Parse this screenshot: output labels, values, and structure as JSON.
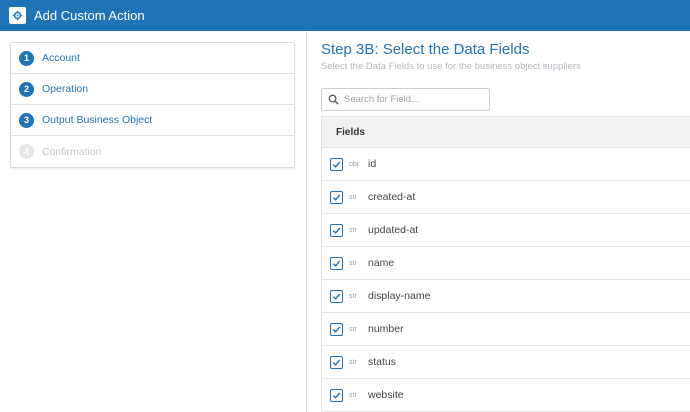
{
  "header": {
    "title": "Add Custom Action"
  },
  "steps": [
    {
      "num": "1",
      "label": "Account",
      "enabled": true
    },
    {
      "num": "2",
      "label": "Operation",
      "enabled": true
    },
    {
      "num": "3",
      "label": "Output Business Object",
      "enabled": true
    },
    {
      "num": "4",
      "label": "Confirmation",
      "enabled": false
    }
  ],
  "main": {
    "title": "Step 3B: Select the Data Fields",
    "subtitle": "Select the Data Fields to use for the business object suppliers",
    "search_placeholder": "Search for Field...",
    "column_header": "Fields"
  },
  "fields": [
    {
      "type": "obj",
      "name": "id",
      "checked": true
    },
    {
      "type": "str",
      "name": "created-at",
      "checked": true
    },
    {
      "type": "str",
      "name": "updated-at",
      "checked": true
    },
    {
      "type": "str",
      "name": "name",
      "checked": true
    },
    {
      "type": "str",
      "name": "display-name",
      "checked": true
    },
    {
      "type": "str",
      "name": "number",
      "checked": true
    },
    {
      "type": "str",
      "name": "status",
      "checked": true
    },
    {
      "type": "str",
      "name": "website",
      "checked": true
    }
  ],
  "colors": {
    "primary": "#1f73b7",
    "disabled": "#c9c9c9"
  }
}
